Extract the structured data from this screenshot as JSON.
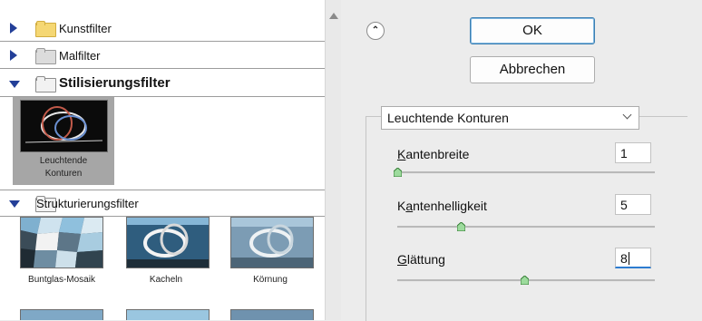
{
  "categories": [
    {
      "label": "Kunstfilter",
      "expanded": false,
      "folder": "yellow"
    },
    {
      "label": "Malfilter",
      "expanded": false,
      "folder": "gray"
    },
    {
      "label": "Stilisierungsfilter",
      "expanded": true,
      "folder": "open"
    },
    {
      "label": "Strukturierungsfilter",
      "expanded": true,
      "folder": "open"
    }
  ],
  "stilisierung_thumbs": [
    {
      "label_line1": "Leuchtende",
      "label_line2": "Konturen",
      "selected": true
    }
  ],
  "struktur_thumbs": [
    {
      "label": "Buntglas-Mosaik"
    },
    {
      "label": "Kacheln"
    },
    {
      "label": "Körnung"
    }
  ],
  "buttons": {
    "ok": "OK",
    "cancel": "Abbrechen"
  },
  "filter_select": {
    "value": "Leuchtende Konturen"
  },
  "params": [
    {
      "label_underline": "K",
      "label_rest": "antenbreite",
      "value": "1",
      "slider_level": 0.0
    },
    {
      "label_pre": "K",
      "label_underline": "a",
      "label_rest": "ntenhelligkeit",
      "value": "5",
      "slider_level": 0.25
    },
    {
      "label_underline": "G",
      "label_rest": "lättung",
      "value": "8",
      "slider_level": 0.5
    }
  ],
  "colors": {
    "accent": "#2d7cd0",
    "triangle": "#233f98",
    "selected_bg": "#a6a6a6"
  }
}
